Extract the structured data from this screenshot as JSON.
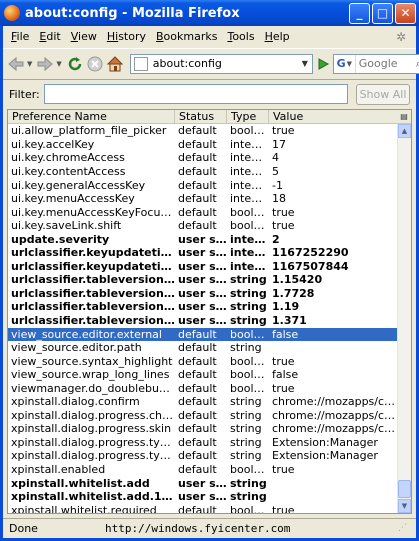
{
  "window": {
    "title": "about:config - Mozilla Firefox",
    "minimize": "_",
    "maximize": "□",
    "close": "✕"
  },
  "menubar": {
    "items": [
      {
        "key": "F",
        "rest": "ile"
      },
      {
        "key": "E",
        "rest": "dit"
      },
      {
        "key": "V",
        "rest": "iew"
      },
      {
        "key": "Hi",
        "rest": "story"
      },
      {
        "key": "B",
        "rest": "ookmarks"
      },
      {
        "key": "T",
        "rest": "ools"
      },
      {
        "key": "H",
        "rest": "elp"
      }
    ]
  },
  "navbar": {
    "url": "about:config",
    "search_engine": "G",
    "search_placeholder": "Google"
  },
  "filter": {
    "label": "Filter:",
    "value": "",
    "show_all_label": "Show All"
  },
  "table": {
    "columns": [
      "Preference Name",
      "Status",
      "Type",
      "Value"
    ],
    "rows": [
      {
        "name": "ui.allow_platform_file_picker",
        "status": "default",
        "type": "boolean",
        "value": "true",
        "bold": false,
        "selected": false
      },
      {
        "name": "ui.key.accelKey",
        "status": "default",
        "type": "integer",
        "value": "17",
        "bold": false,
        "selected": false
      },
      {
        "name": "ui.key.chromeAccess",
        "status": "default",
        "type": "integer",
        "value": "4",
        "bold": false,
        "selected": false
      },
      {
        "name": "ui.key.contentAccess",
        "status": "default",
        "type": "integer",
        "value": "5",
        "bold": false,
        "selected": false
      },
      {
        "name": "ui.key.generalAccessKey",
        "status": "default",
        "type": "integer",
        "value": "-1",
        "bold": false,
        "selected": false
      },
      {
        "name": "ui.key.menuAccessKey",
        "status": "default",
        "type": "integer",
        "value": "18",
        "bold": false,
        "selected": false
      },
      {
        "name": "ui.key.menuAccessKeyFocuses",
        "status": "default",
        "type": "boolean",
        "value": "true",
        "bold": false,
        "selected": false
      },
      {
        "name": "ui.key.saveLink.shift",
        "status": "default",
        "type": "boolean",
        "value": "true",
        "bold": false,
        "selected": false
      },
      {
        "name": "update.severity",
        "status": "user set",
        "type": "integer",
        "value": "2",
        "bold": true,
        "selected": false
      },
      {
        "name": "urlclassifier.keyupdatetime.ht...",
        "status": "user set",
        "type": "integer",
        "value": "1167252290",
        "bold": true,
        "selected": false
      },
      {
        "name": "urlclassifier.keyupdatetime.ht...",
        "status": "user set",
        "type": "integer",
        "value": "1167507844",
        "bold": true,
        "selected": false
      },
      {
        "name": "urlclassifier.tableversion.goog...",
        "status": "user set",
        "type": "string",
        "value": "1.15420",
        "bold": true,
        "selected": false
      },
      {
        "name": "urlclassifier.tableversion.goog...",
        "status": "user set",
        "type": "string",
        "value": "1.7728",
        "bold": true,
        "selected": false
      },
      {
        "name": "urlclassifier.tableversion.goog...",
        "status": "user set",
        "type": "string",
        "value": "1.19",
        "bold": true,
        "selected": false
      },
      {
        "name": "urlclassifier.tableversion.goog...",
        "status": "user set",
        "type": "string",
        "value": "1.371",
        "bold": true,
        "selected": false
      },
      {
        "name": "view_source.editor.external",
        "status": "default",
        "type": "boolean",
        "value": "false",
        "bold": false,
        "selected": true
      },
      {
        "name": "view_source.editor.path",
        "status": "default",
        "type": "string",
        "value": "",
        "bold": false,
        "selected": false
      },
      {
        "name": "view_source.syntax_highlight",
        "status": "default",
        "type": "boolean",
        "value": "true",
        "bold": false,
        "selected": false
      },
      {
        "name": "view_source.wrap_long_lines",
        "status": "default",
        "type": "boolean",
        "value": "false",
        "bold": false,
        "selected": false
      },
      {
        "name": "viewmanager.do_doublebuffering",
        "status": "default",
        "type": "boolean",
        "value": "true",
        "bold": false,
        "selected": false
      },
      {
        "name": "xpinstall.dialog.confirm",
        "status": "default",
        "type": "string",
        "value": "chrome://mozapps/conte...",
        "bold": false,
        "selected": false
      },
      {
        "name": "xpinstall.dialog.progress.chrome",
        "status": "default",
        "type": "string",
        "value": "chrome://mozapps/conte...",
        "bold": false,
        "selected": false
      },
      {
        "name": "xpinstall.dialog.progress.skin",
        "status": "default",
        "type": "string",
        "value": "chrome://mozapps/conte...",
        "bold": false,
        "selected": false
      },
      {
        "name": "xpinstall.dialog.progress.type.chr...",
        "status": "default",
        "type": "string",
        "value": "Extension:Manager",
        "bold": false,
        "selected": false
      },
      {
        "name": "xpinstall.dialog.progress.type.skin",
        "status": "default",
        "type": "string",
        "value": "Extension:Manager",
        "bold": false,
        "selected": false
      },
      {
        "name": "xpinstall.enabled",
        "status": "default",
        "type": "boolean",
        "value": "true",
        "bold": false,
        "selected": false
      },
      {
        "name": "xpinstall.whitelist.add",
        "status": "user set",
        "type": "string",
        "value": "",
        "bold": true,
        "selected": false
      },
      {
        "name": "xpinstall.whitelist.add.103",
        "status": "user set",
        "type": "string",
        "value": "",
        "bold": true,
        "selected": false
      },
      {
        "name": "xpinstall.whitelist.required",
        "status": "default",
        "type": "boolean",
        "value": "true",
        "bold": false,
        "selected": false
      }
    ]
  },
  "statusbar": {
    "status": "Done",
    "url": "http://windows.fyicenter.com"
  },
  "colors": {
    "titlebar": "#0650de",
    "selection": "#316ac5",
    "chrome_bg": "#ece9d8"
  }
}
